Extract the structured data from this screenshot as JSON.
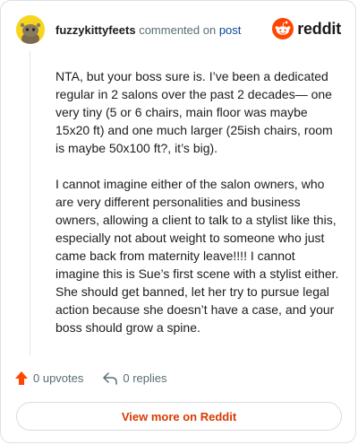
{
  "header": {
    "username": "fuzzykittyfeets",
    "action_text": "commented on",
    "post_link": "post",
    "brand_name": "reddit"
  },
  "comment": {
    "paragraphs": [
      "NTA, but your boss sure is. I’ve been a dedicated regular in 2 salons over the past 2 decades— one very tiny (5 or 6 chairs, main floor was maybe 15x20 ft) and one much larger (25ish chairs, room is maybe 50x100 ft?, it’s big).",
      "I cannot imagine either of the salon owners, who are very different personalities and business owners, allowing a client to talk to a stylist like this, especially not about weight to someone who just came back from maternity leave!!!! I cannot imagine this is Sue’s first scene with a stylist either. She should get banned, let her try to pursue legal action because she doesn’t have a case, and your boss should grow a spine."
    ]
  },
  "footer": {
    "upvotes_label": "0 upvotes",
    "replies_label": "0 replies"
  },
  "cta": {
    "view_more_label": "View more on Reddit"
  },
  "icons": {
    "avatar": "snoo-avatar",
    "brand": "reddit-logo-icon",
    "upvote": "upvote-arrow-icon",
    "reply": "reply-arrow-icon"
  },
  "colors": {
    "brand_orange": "#ff4500",
    "upvote_orange": "#ff4500",
    "link_blue": "#0a449b",
    "cta_text": "#d93a00",
    "avatar_yellow": "#f7d51f"
  }
}
